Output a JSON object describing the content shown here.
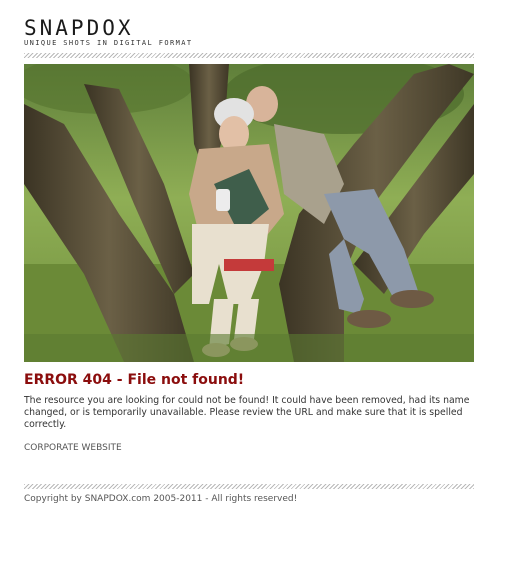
{
  "header": {
    "logo": "SNAPDOX",
    "tagline": "UNIQUE SHOTS IN DIGITAL FORMAT"
  },
  "error": {
    "title": "ERROR 404 - File not found!",
    "message": "The resource you are looking for could not be found! It could have been removed, had its name changed, or is temporarily unavailable. Please review the URL and make sure that it is spelled correctly."
  },
  "links": {
    "corporate": "CORPORATE WEBSITE"
  },
  "footer": {
    "copyright": "Copyright by SNAPDOX.com 2005-2011  -  All rights reserved!"
  },
  "colors": {
    "error_title": "#8b0d0d",
    "hatch": "#b9b9b9"
  }
}
